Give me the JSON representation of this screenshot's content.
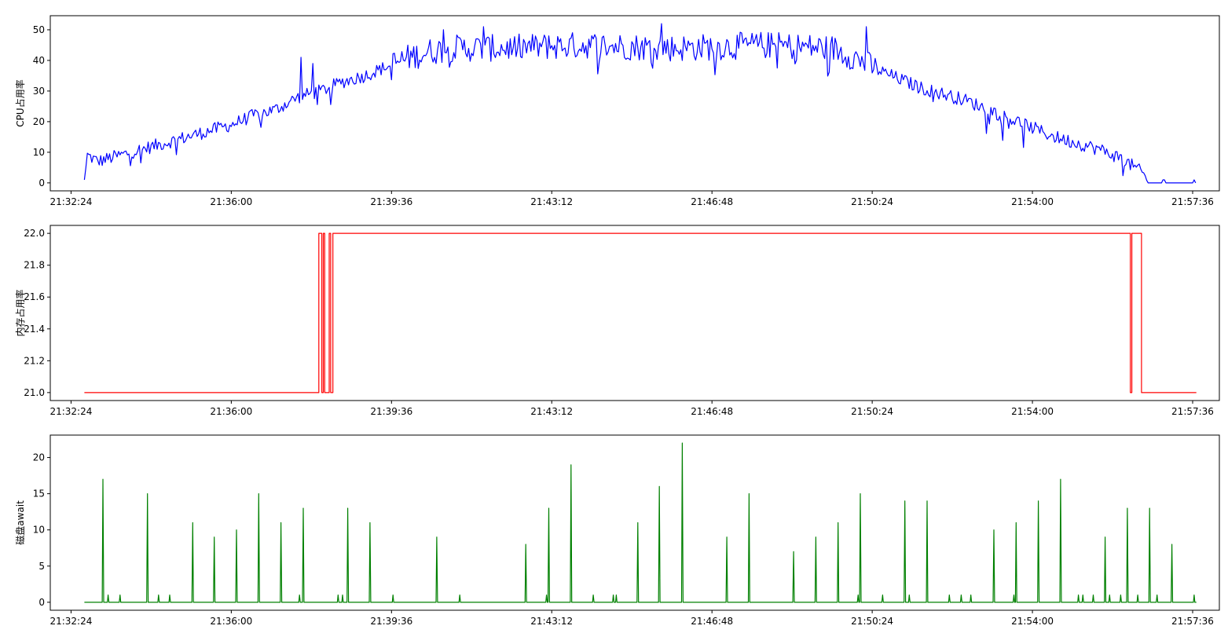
{
  "chart_data": [
    {
      "type": "line",
      "ylabel": "CPU占用率",
      "color": "#0000ff",
      "ylim": [
        -2.6,
        54.6
      ],
      "yticks": [
        0,
        10,
        20,
        30,
        40,
        50
      ],
      "ytick_labels": [
        "0",
        "10",
        "20",
        "30",
        "40",
        "50"
      ],
      "xlim": [
        "21:31:56",
        "21:58:12"
      ],
      "xtick_labels": [
        "21:32:24",
        "21:36:00",
        "21:39:36",
        "21:43:12",
        "21:46:48",
        "21:50:24",
        "21:54:00",
        "21:57:36"
      ],
      "x_start": "21:32:42",
      "x_end": "21:57:41",
      "series": [
        {
          "profile": [
            [
              "21:32:42",
              1
            ],
            [
              "21:32:46",
              9
            ],
            [
              "21:33:00",
              7
            ],
            [
              "21:33:30",
              9
            ],
            [
              "21:34:00",
              11
            ],
            [
              "21:34:30",
              13
            ],
            [
              "21:35:00",
              15
            ],
            [
              "21:35:30",
              17
            ],
            [
              "21:36:00",
              19
            ],
            [
              "21:36:30",
              22
            ],
            [
              "21:37:00",
              24
            ],
            [
              "21:37:30",
              28
            ],
            [
              "21:38:00",
              30
            ],
            [
              "21:38:30",
              33
            ],
            [
              "21:39:00",
              35
            ],
            [
              "21:39:30",
              38
            ],
            [
              "21:40:00",
              41
            ],
            [
              "21:40:30",
              43
            ],
            [
              "21:41:00",
              44
            ],
            [
              "21:42:00",
              44
            ],
            [
              "21:44:00",
              45
            ],
            [
              "21:46:00",
              44
            ],
            [
              "21:48:00",
              45
            ],
            [
              "21:49:30",
              44
            ],
            [
              "21:50:00",
              41
            ],
            [
              "21:50:30",
              37
            ],
            [
              "21:51:00",
              34
            ],
            [
              "21:51:30",
              31
            ],
            [
              "21:52:00",
              29
            ],
            [
              "21:52:30",
              27
            ],
            [
              "21:53:00",
              24
            ],
            [
              "21:53:30",
              21
            ],
            [
              "21:54:00",
              18
            ],
            [
              "21:54:30",
              15
            ],
            [
              "21:55:00",
              13
            ],
            [
              "21:55:30",
              11
            ],
            [
              "21:56:00",
              8
            ],
            [
              "21:56:30",
              3
            ],
            [
              "21:56:35",
              0
            ],
            [
              "21:57:41",
              0
            ]
          ],
          "spikes": [
            [
              "21:37:33",
              41
            ],
            [
              "21:37:49",
              39
            ],
            [
              "21:40:45",
              50
            ],
            [
              "21:41:40",
              51
            ],
            [
              "21:43:08",
              48
            ],
            [
              "21:45:40",
              52
            ],
            [
              "21:50:15",
              51
            ]
          ]
        }
      ]
    },
    {
      "type": "line",
      "ylabel": "内存占用率",
      "color": "#ff0000",
      "ylim": [
        20.95,
        22.05
      ],
      "yticks": [
        21.0,
        21.2,
        21.4,
        21.6,
        21.8,
        22.0
      ],
      "ytick_labels": [
        "21.0",
        "21.2",
        "21.4",
        "21.6",
        "21.8",
        "22.0"
      ],
      "xlim": [
        "21:31:56",
        "21:58:12"
      ],
      "xtick_labels": [
        "21:32:24",
        "21:36:00",
        "21:39:36",
        "21:43:12",
        "21:46:48",
        "21:50:24",
        "21:54:00",
        "21:57:36"
      ],
      "series": [
        {
          "points": [
            [
              "21:32:42",
              21.0
            ],
            [
              "21:37:58",
              21.0
            ],
            [
              "21:37:58",
              22.0
            ],
            [
              "21:38:02",
              22.0
            ],
            [
              "21:38:02",
              21.0
            ],
            [
              "21:38:04",
              21.0
            ],
            [
              "21:38:04",
              22.0
            ],
            [
              "21:38:06",
              22.0
            ],
            [
              "21:38:06",
              21.0
            ],
            [
              "21:38:12",
              21.0
            ],
            [
              "21:38:12",
              22.0
            ],
            [
              "21:38:14",
              22.0
            ],
            [
              "21:38:14",
              21.0
            ],
            [
              "21:38:17",
              21.0
            ],
            [
              "21:38:17",
              22.0
            ],
            [
              "21:56:12",
              22.0
            ],
            [
              "21:56:12",
              21.0
            ],
            [
              "21:56:14",
              21.0
            ],
            [
              "21:56:14",
              22.0
            ],
            [
              "21:56:27",
              22.0
            ],
            [
              "21:56:27",
              21.0
            ],
            [
              "21:57:41",
              21.0
            ]
          ]
        }
      ]
    },
    {
      "type": "line",
      "ylabel": "磁盘await",
      "color": "#008000",
      "ylim": [
        -1.1,
        23.1
      ],
      "yticks": [
        0,
        5,
        10,
        15,
        20
      ],
      "ytick_labels": [
        "0",
        "5",
        "10",
        "15",
        "20"
      ],
      "xlim": [
        "21:31:56",
        "21:58:12"
      ],
      "xtick_labels": [
        "21:32:24",
        "21:36:00",
        "21:39:36",
        "21:43:12",
        "21:46:48",
        "21:50:24",
        "21:54:00",
        "21:57:36"
      ],
      "x_start": "21:32:42",
      "x_end": "21:57:41",
      "series": [
        {
          "spikes": [
            [
              "21:33:07",
              17
            ],
            [
              "21:33:14",
              1
            ],
            [
              "21:33:30",
              1
            ],
            [
              "21:34:07",
              15
            ],
            [
              "21:34:22",
              1
            ],
            [
              "21:34:37",
              1
            ],
            [
              "21:35:08",
              11
            ],
            [
              "21:35:37",
              9
            ],
            [
              "21:36:07",
              10
            ],
            [
              "21:36:37",
              15
            ],
            [
              "21:37:07",
              11
            ],
            [
              "21:37:32",
              1
            ],
            [
              "21:37:37",
              13
            ],
            [
              "21:38:24",
              1
            ],
            [
              "21:38:30",
              1
            ],
            [
              "21:38:37",
              13
            ],
            [
              "21:39:07",
              11
            ],
            [
              "21:39:38",
              1
            ],
            [
              "21:40:37",
              9
            ],
            [
              "21:41:08",
              1
            ],
            [
              "21:42:37",
              8
            ],
            [
              "21:43:05",
              1
            ],
            [
              "21:43:08",
              13
            ],
            [
              "21:43:38",
              19
            ],
            [
              "21:44:08",
              1
            ],
            [
              "21:44:35",
              1
            ],
            [
              "21:44:39",
              1
            ],
            [
              "21:45:08",
              11
            ],
            [
              "21:45:37",
              16
            ],
            [
              "21:46:08",
              22
            ],
            [
              "21:47:08",
              9
            ],
            [
              "21:47:38",
              15
            ],
            [
              "21:48:38",
              7
            ],
            [
              "21:49:08",
              9
            ],
            [
              "21:49:38",
              11
            ],
            [
              "21:50:05",
              1
            ],
            [
              "21:50:08",
              15
            ],
            [
              "21:50:38",
              1
            ],
            [
              "21:51:08",
              14
            ],
            [
              "21:51:14",
              1
            ],
            [
              "21:51:38",
              14
            ],
            [
              "21:52:08",
              1
            ],
            [
              "21:52:24",
              1
            ],
            [
              "21:52:37",
              1
            ],
            [
              "21:53:08",
              10
            ],
            [
              "21:53:35",
              1
            ],
            [
              "21:53:38",
              11
            ],
            [
              "21:54:08",
              14
            ],
            [
              "21:54:38",
              17
            ],
            [
              "21:55:02",
              1
            ],
            [
              "21:55:08",
              1
            ],
            [
              "21:55:22",
              1
            ],
            [
              "21:55:38",
              9
            ],
            [
              "21:55:44",
              1
            ],
            [
              "21:55:59",
              1
            ],
            [
              "21:56:08",
              13
            ],
            [
              "21:56:22",
              1
            ],
            [
              "21:56:38",
              13
            ],
            [
              "21:56:48",
              1
            ],
            [
              "21:57:08",
              8
            ],
            [
              "21:57:38",
              1
            ]
          ]
        }
      ]
    }
  ]
}
